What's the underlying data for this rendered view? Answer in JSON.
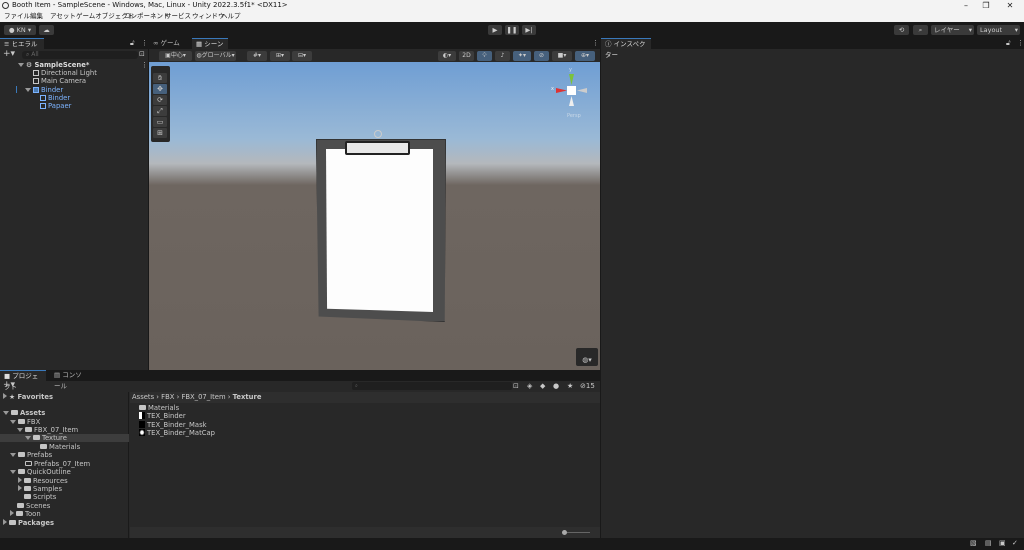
{
  "window": {
    "title": "Booth Item - SampleScene - Windows, Mac, Linux - Unity 2022.3.5f1* <DX11>"
  },
  "menu": [
    "ファイル",
    "編集",
    "アセット",
    "ゲームオブジェクト",
    "コンポーネント",
    "サービス",
    "ウィンドウ",
    "ヘルプ"
  ],
  "toolbar": {
    "account": "KN",
    "layers": "レイヤー",
    "layout": "Layout"
  },
  "hierarchy": {
    "tab": "ヒエラルキー",
    "search_placeholder": "All",
    "items": [
      "SampleScene*",
      "Directional Light",
      "Main Camera",
      "Binder",
      "Binder",
      "Papaer"
    ]
  },
  "scene": {
    "tabs": [
      "ゲーム",
      "シーン"
    ],
    "pivot": "中心",
    "space": "グローバル",
    "mode_2d": "2D",
    "persp": "Persp",
    "axis_x": "x",
    "axis_y": "y"
  },
  "inspector": {
    "tab": "インスペクター"
  },
  "project": {
    "tabs": [
      "プロジェクト",
      "コンソール"
    ],
    "hidden_count": "15",
    "tree": [
      "Favorites",
      "Assets",
      "FBX",
      "FBX_07_Item",
      "Texture",
      "Materials",
      "Prefabs",
      "Prefabs_07_Item",
      "QuickOutline",
      "Resources",
      "Samples",
      "Scripts",
      "Scenes",
      "Toon",
      "Packages"
    ],
    "breadcrumb": [
      "Assets",
      "FBX",
      "FBX_07_Item",
      "Texture"
    ],
    "files": [
      "Materials",
      "TEX_Binder",
      "TEX_Binder_Mask",
      "TEX_Binder_MatCap"
    ]
  },
  "colors": {
    "accent": "#3a79bb",
    "selected_text": "#7cb3ff"
  }
}
